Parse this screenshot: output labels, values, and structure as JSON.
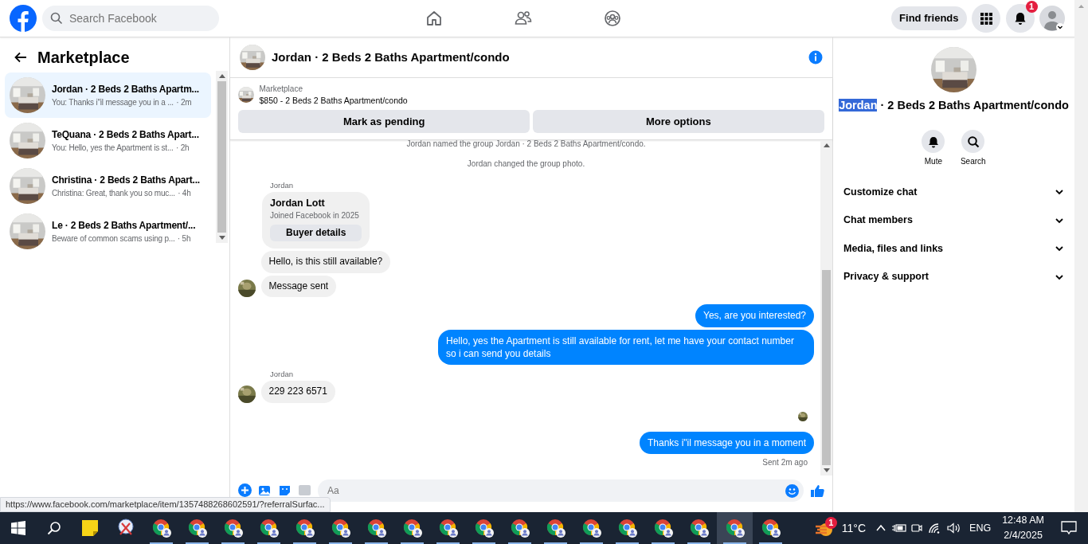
{
  "topbar": {
    "search": {
      "placeholder": "Search Facebook"
    },
    "find_friends": "Find friends",
    "notification_count": "1"
  },
  "sidebar": {
    "title": "Marketplace",
    "conversations": [
      {
        "title": "Jordan · 2 Beds 2 Baths Apartm...",
        "preview": "You: Thanks i\"il message you in a ...",
        "time": "· 2m",
        "selected": true
      },
      {
        "title": "TeQuana · 2 Beds 2 Baths Apart...",
        "preview": "You: Hello, yes the Apartment is st...",
        "time": "· 2h",
        "selected": false
      },
      {
        "title": "Christina · 2 Beds 2 Baths Apart...",
        "preview": "Christina: Great, thank you so muc...",
        "time": "· 4h",
        "selected": false
      },
      {
        "title": "Le · 2 Beds 2 Baths Apartment/...",
        "preview": "Beware of common scams using p...",
        "time": "· 5h",
        "selected": false
      }
    ]
  },
  "chat": {
    "title": "Jordan · 2 Beds 2 Baths Apartment/condo",
    "listing": {
      "label": "Marketplace",
      "price_title": "$850 - 2 Beds 2 Baths Apartment/condo"
    },
    "actions": [
      "Mark as pending",
      "More options"
    ],
    "messages": [
      {
        "kind": "system",
        "text": "Jordan named the group Jordan · 2 Beds 2 Baths Apartment/condo."
      },
      {
        "kind": "system",
        "text": "Jordan changed the group photo."
      },
      {
        "kind": "sender",
        "text": "Jordan"
      },
      {
        "kind": "profile",
        "name": "Jordan Lott",
        "subtitle": "Joined Facebook in 2025",
        "button": "Buyer details"
      },
      {
        "kind": "incoming",
        "text": "Hello, is this still available?",
        "avatar": false
      },
      {
        "kind": "incoming",
        "text": "Message sent",
        "avatar": true
      },
      {
        "kind": "outgoing",
        "text": "Yes, are you interested?"
      },
      {
        "kind": "outgoing",
        "text": "Hello, yes the Apartment is still available for rent, let me have your contact number so i can send you details"
      },
      {
        "kind": "sender",
        "text": "Jordan"
      },
      {
        "kind": "incoming",
        "text": "229 223 6571",
        "avatar": true
      },
      {
        "kind": "seen"
      },
      {
        "kind": "outgoing",
        "text": "Thanks i\"il message you in a moment"
      },
      {
        "kind": "status",
        "text": "Sent 2m ago"
      }
    ],
    "composer": {
      "placeholder": "Aa"
    }
  },
  "details": {
    "title_parts": [
      {
        "text": "Jordan",
        "highlighted": true
      },
      {
        "text": " · 2 Beds 2 Baths Apartment/condo",
        "highlighted": false
      }
    ],
    "actions": [
      {
        "kind": "mute",
        "label": "Mute"
      },
      {
        "kind": "search",
        "label": "Search"
      }
    ],
    "sections": [
      {
        "label": "Customize chat",
        "expanded": false
      },
      {
        "label": "Chat members",
        "expanded": false
      },
      {
        "label": "Media, files and links",
        "expanded": false
      },
      {
        "label": "Privacy & support",
        "expanded": false
      }
    ]
  },
  "link_preview": "https://www.facebook.com/marketplace/item/1357488268602591/?referralSurfac...",
  "taskbar": {
    "apps": [
      {
        "kind": "sticky",
        "selected": false
      },
      {
        "kind": "snip",
        "selected": false
      },
      {
        "kind": "chrome",
        "selected": false
      },
      {
        "kind": "chrome",
        "selected": false
      },
      {
        "kind": "chrome",
        "selected": false
      },
      {
        "kind": "chrome",
        "selected": false
      },
      {
        "kind": "chrome",
        "selected": false
      },
      {
        "kind": "chrome",
        "selected": false
      },
      {
        "kind": "chrome",
        "selected": false
      },
      {
        "kind": "chrome",
        "selected": false
      },
      {
        "kind": "chrome",
        "selected": false
      },
      {
        "kind": "chrome",
        "selected": false
      },
      {
        "kind": "chrome",
        "selected": false
      },
      {
        "kind": "chrome",
        "selected": false
      },
      {
        "kind": "chrome",
        "selected": false
      },
      {
        "kind": "chrome",
        "selected": false
      },
      {
        "kind": "chrome",
        "selected": false
      },
      {
        "kind": "chrome",
        "selected": false
      },
      {
        "kind": "chrome",
        "selected": true
      },
      {
        "kind": "chrome",
        "selected": false
      }
    ],
    "weather_badge": "1",
    "temperature": "11°C",
    "language": "ENG",
    "time": "12:48 AM",
    "date": "2/4/2025"
  }
}
